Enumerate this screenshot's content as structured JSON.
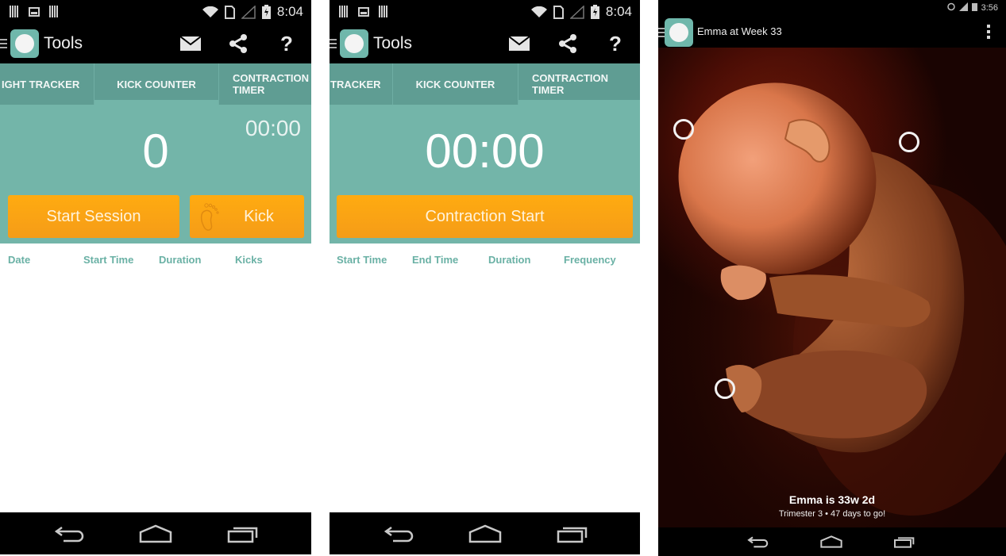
{
  "status_bar": {
    "time_left_phones": "8:04",
    "time_right_phone": "3:56"
  },
  "screens": [
    {
      "action_bar": {
        "title": "Tools",
        "icons": [
          "menu-icon",
          "app-logo",
          "mail-icon",
          "share-icon",
          "help-icon"
        ],
        "help_label": "?"
      },
      "tabs": [
        {
          "label": "IGHT TRACKER",
          "selected": false
        },
        {
          "label": "KICK COUNTER",
          "selected": true
        },
        {
          "label": "CONTRACTION TIMER",
          "selected": false
        }
      ],
      "kick_count": "0",
      "session_timer": "00:00",
      "buttons": {
        "start_session": "Start Session",
        "kick": "Kick"
      },
      "columns": [
        "Date",
        "Start Time",
        "Duration",
        "Kicks"
      ]
    },
    {
      "action_bar": {
        "title": "Tools",
        "help_label": "?"
      },
      "tabs": [
        {
          "label": "TRACKER",
          "selected": false
        },
        {
          "label": "KICK COUNTER",
          "selected": false
        },
        {
          "label": "CONTRACTION TIMER",
          "selected": true
        }
      ],
      "timer": "00:00",
      "buttons": {
        "contraction_start": "Contraction Start"
      },
      "columns": [
        "Start Time",
        "End Time",
        "Duration",
        "Frequency"
      ]
    },
    {
      "action_bar": {
        "title": "Emma at Week 33"
      },
      "baby_summary": "Emma is 33w 2d",
      "baby_detail": "Trimester 3 • 47 days to go!",
      "hotspots": [
        "head-hotspot",
        "back-hotspot",
        "foot-hotspot"
      ]
    }
  ],
  "colors": {
    "teal_panel": "#73b5a9",
    "teal_tabs": "#5f9d93",
    "orange_button": "#ffab10",
    "column_header": "#6ab1a5"
  }
}
